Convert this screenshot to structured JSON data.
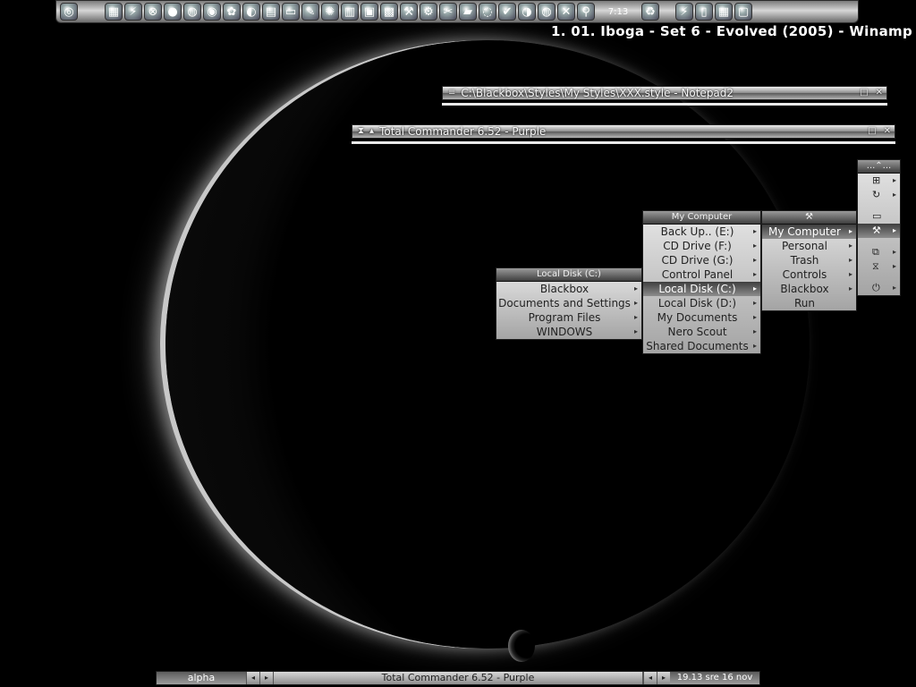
{
  "toolbar": {
    "icons": [
      "browser-icon",
      "calendar-icon",
      "lightning-icon",
      "lifebuoy-icon",
      "record-icon",
      "globe-icon",
      "cd-icon",
      "fruityloops-icon",
      "disc-icon",
      "book-icon",
      "document-icon",
      "paint-icon",
      "palette-icon",
      "film-icon",
      "monitor-icon",
      "picture-icon",
      "tools-icon",
      "gear-icon",
      "wrench-icon",
      "folder-icon",
      "lifebuoy-icon",
      "ok-icon",
      "cd-icon",
      "globe-icon",
      "scissors-icon",
      "link-icon"
    ],
    "clock": "7:13",
    "right_icons": [
      "recycle-bin-icon",
      "lightning-icon",
      "notepad-icon",
      "calendar-icon",
      "terminal-icon"
    ]
  },
  "winamp": {
    "title": "1. 01. Iboga - Set 6 - Evolved (2005) - Winamp"
  },
  "windows": {
    "notepad": {
      "title": "C:\\Blackbox\\Styles\\My Styles\\XXX.style - Notepad2"
    },
    "tc": {
      "title": "Total Commander 6.52 - Purple"
    }
  },
  "menus": {
    "local_disk": {
      "title": "Local Disk (C:)",
      "items": [
        "Blackbox",
        "Documents and Settings",
        "Program Files",
        "WINDOWS"
      ]
    },
    "my_computer": {
      "title": "My Computer",
      "items": [
        "Back Up.. (E:)",
        "CD Drive (F:)",
        "CD Drive (G:)",
        "Control Panel",
        "Local Disk (C:)",
        "Local Disk (D:)",
        "My Documents",
        "Nero Scout",
        "Shared Documents"
      ],
      "selected": 4
    },
    "tools": {
      "title": "⚒",
      "items": [
        "My Computer",
        "Personal",
        "Trash",
        "Controls",
        "Blackbox",
        "Run"
      ],
      "selected": 0
    },
    "root": {
      "title": "...⌃..."
    }
  },
  "taskbar": {
    "workspace": "alpha",
    "task": "Total Commander 6.52 - Purple",
    "clock": "19.13 sre 16 nov"
  }
}
